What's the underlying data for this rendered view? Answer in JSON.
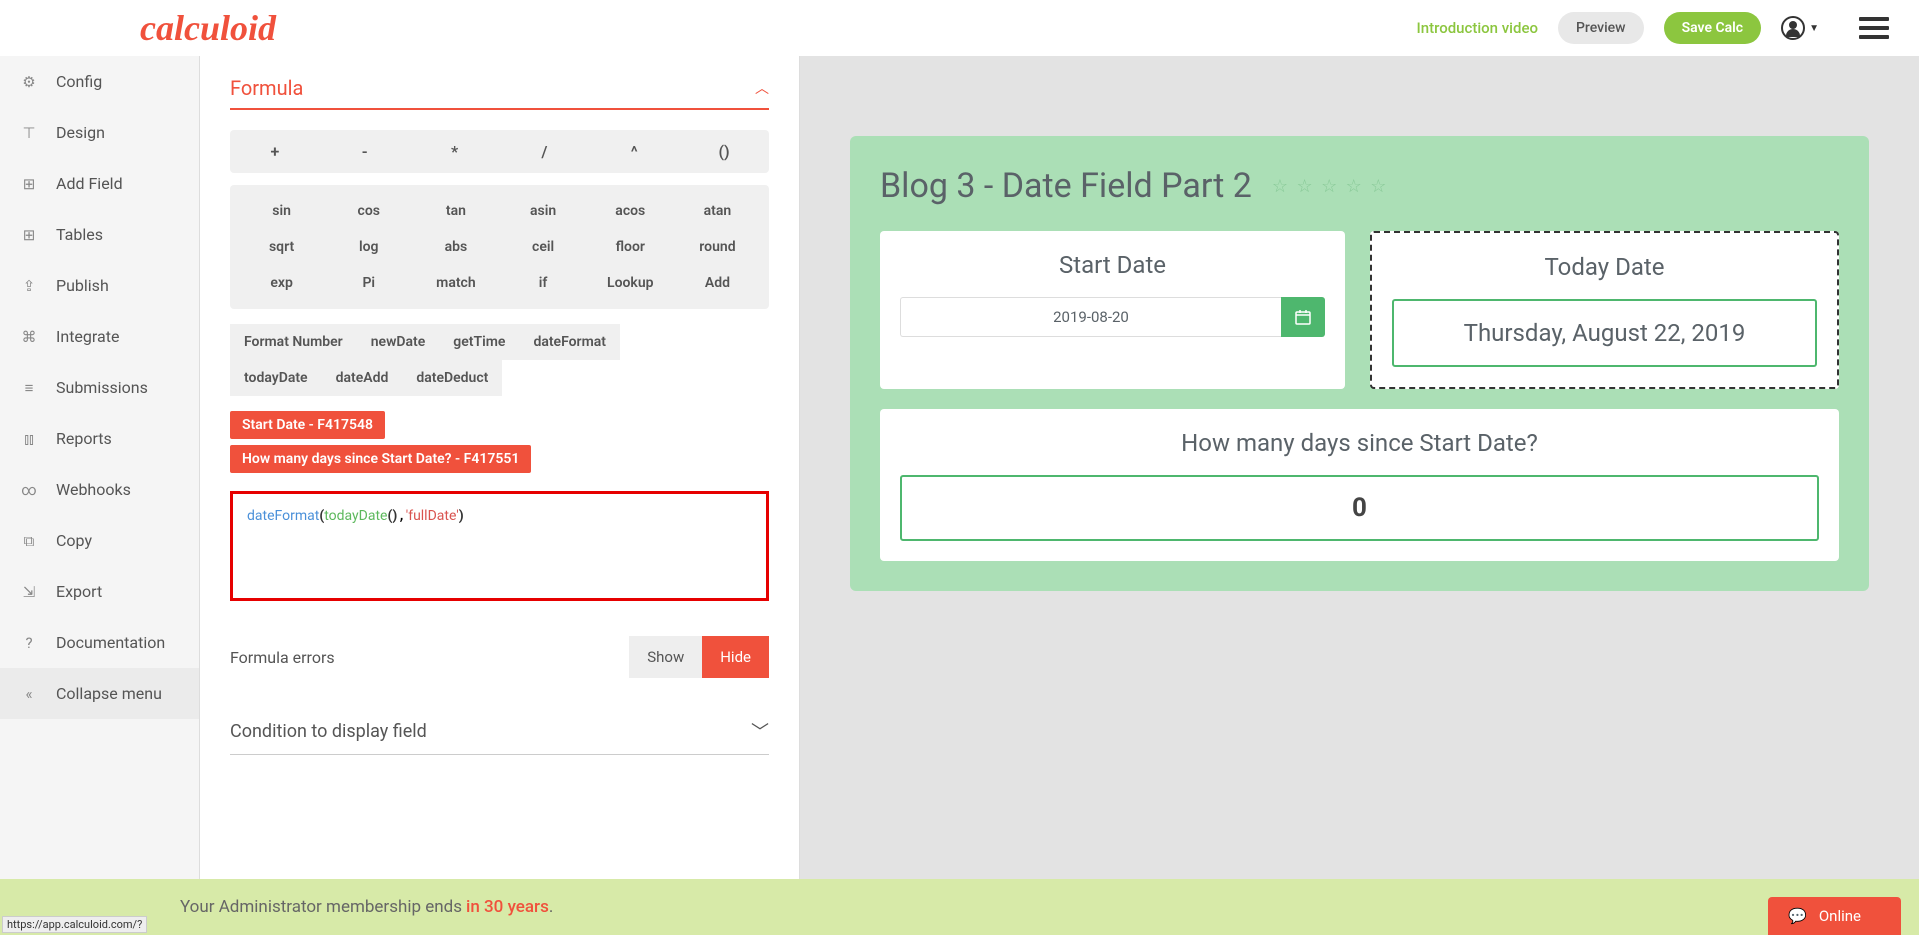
{
  "header": {
    "logo": "calculoid",
    "intro_link": "Introduction video",
    "preview": "Preview",
    "save": "Save Calc"
  },
  "sidebar": {
    "items": [
      {
        "label": "Config",
        "icon": "gear"
      },
      {
        "label": "Design",
        "icon": "design"
      },
      {
        "label": "Add Field",
        "icon": "plus"
      },
      {
        "label": "Tables",
        "icon": "table"
      },
      {
        "label": "Publish",
        "icon": "publish"
      },
      {
        "label": "Integrate",
        "icon": "integrate"
      },
      {
        "label": "Submissions",
        "icon": "submissions"
      },
      {
        "label": "Reports",
        "icon": "reports"
      },
      {
        "label": "Webhooks",
        "icon": "webhooks"
      },
      {
        "label": "Copy",
        "icon": "copy"
      },
      {
        "label": "Export",
        "icon": "export"
      },
      {
        "label": "Documentation",
        "icon": "help"
      },
      {
        "label": "Collapse menu",
        "icon": "collapse"
      }
    ]
  },
  "editor": {
    "section_title": "Formula",
    "operators": [
      "+",
      "-",
      "*",
      "/",
      "^",
      "()"
    ],
    "functions_row1": [
      "sin",
      "cos",
      "tan",
      "asin",
      "acos",
      "atan"
    ],
    "functions_row2": [
      "sqrt",
      "log",
      "abs",
      "ceil",
      "floor",
      "round"
    ],
    "functions_row3": [
      "exp",
      "Pi",
      "match",
      "if",
      "Lookup",
      "Add"
    ],
    "functions_row4": [
      "Format Number",
      "newDate",
      "getTime",
      "dateFormat"
    ],
    "functions_row5": [
      "todayDate",
      "dateAdd",
      "dateDeduct"
    ],
    "field_tags": [
      "Start Date - F417548",
      "How many days since Start Date? - F417551"
    ],
    "formula": {
      "fn1": "dateFormat",
      "fn2": "todayDate",
      "arg": "'fullDate'"
    },
    "errors_label": "Formula errors",
    "show": "Show",
    "hide": "Hide",
    "condition_title": "Condition to display field"
  },
  "calculator": {
    "title": "Blog 3 - Date Field Part 2",
    "start_date": {
      "title": "Start Date",
      "value": "2019-08-20"
    },
    "today_date": {
      "title": "Today Date",
      "value": "Thursday, August 22, 2019"
    },
    "result": {
      "title": "How many days since Start Date?",
      "value": "0"
    }
  },
  "membership": {
    "text": "Your Administrator membership ends ",
    "highlight": "in 30 years",
    "suffix": "."
  },
  "status_link": "https://app.calculoid.com/?",
  "online": "Online"
}
